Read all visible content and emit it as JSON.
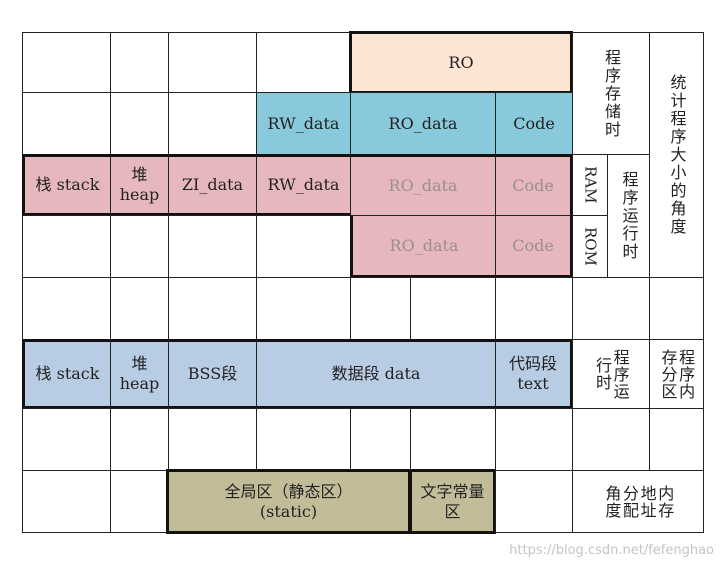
{
  "diagram": {
    "row1": {
      "ro": "RO"
    },
    "row2": {
      "rw_data": "RW_data",
      "ro_data": "RO_data",
      "code": "Code"
    },
    "row3": {
      "stack": "栈 stack",
      "heap": "堆\nheap",
      "zi_data": "ZI_data",
      "rw_data": "RW_data",
      "ro_data": "RO_data",
      "code": "Code"
    },
    "row4": {
      "ro_data": "RO_data",
      "code": "Code"
    },
    "row6": {
      "stack": "栈 stack",
      "heap": "堆\nheap",
      "bss": "BSS段",
      "data": "数据段 data",
      "text": "代码段\ntext"
    },
    "row8": {
      "static": "全局区（静态区）\n(static)",
      "const": "文字常量\n区"
    },
    "side": {
      "program_storage": "程序存储时",
      "ram": "RAM",
      "rom": "ROM",
      "program_runtime": "程序运行时",
      "size_perspective": "统计程序大小的角度",
      "runtime2": "程序运\n行时",
      "memory_partition": "程序内\n存分区",
      "mem_alloc": "内存\n地址\n分配\n角度"
    }
  },
  "watermark": "https://blog.csdn.net/fefenghao",
  "colors": {
    "peach": "#fde5d3",
    "cyan": "#88c9dc",
    "pink": "#e6b8bd",
    "blue": "#b8cce4",
    "olive": "#c3bc99"
  }
}
